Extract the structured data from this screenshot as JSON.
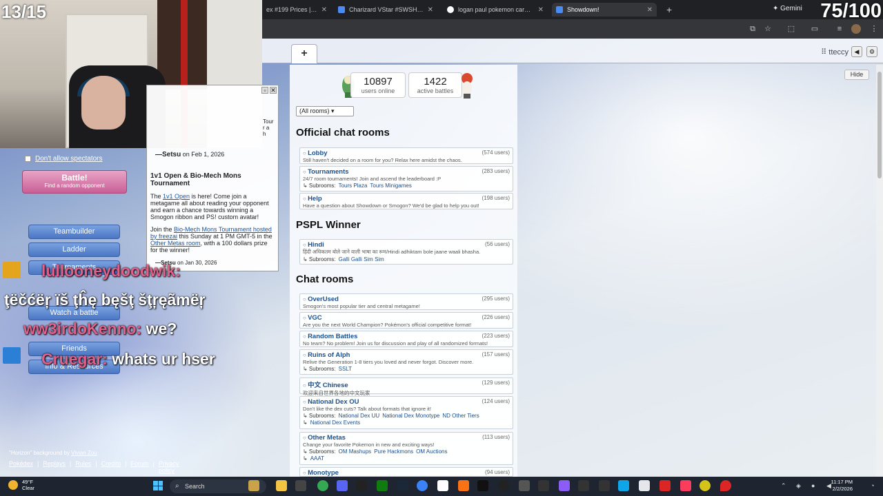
{
  "overlay": {
    "counter_left": "13/15",
    "counter_right": "75/100"
  },
  "browser": {
    "tabs": [
      {
        "label": "ex #199 Prices | Poké",
        "active": false
      },
      {
        "label": "Charizard VStar #SWSH262 Pri",
        "active": false
      },
      {
        "label": "logan paul pokemon card - Go",
        "active": false
      },
      {
        "label": "Showdown!",
        "active": true
      }
    ],
    "new_tab": "+",
    "gemini": "✦ Gemini"
  },
  "showdown": {
    "plus_tab": "+",
    "username": "⠿ tteccy",
    "stats": {
      "users_online_num": "10897",
      "users_online_label": "users online",
      "active_battles_num": "1422",
      "active_battles_label": "active battles"
    },
    "hide_button": "Hide",
    "room_filter": "(All rooms) ▾",
    "sections": [
      {
        "title": "Official chat rooms",
        "rooms": [
          {
            "name": "Lobby",
            "users": "(574 users)",
            "desc": "Still haven't decided on a room for you? Relax here amidst the chaos.",
            "subrooms": []
          },
          {
            "name": "Tournaments",
            "users": "(283 users)",
            "desc": "24/7 room tournaments! Join and ascend the leaderboard :P",
            "subrooms": [
              "Tours Plaza",
              "Tours Minigames"
            ]
          },
          {
            "name": "Help",
            "users": "(198 users)",
            "desc": "Have a question about Showdown or Smogon? We'd be glad to help you out!",
            "subrooms": []
          }
        ]
      },
      {
        "title": "PSPL Winner",
        "rooms": [
          {
            "name": "Hindi",
            "users": "(56 users)",
            "desc": "हिंदी अधिकतम बोले जाने वाली भाषा का रूम/Hindi adhiktam bole jaane waali bhasha.",
            "subrooms": [
              "Galli Galli Sim Sim"
            ]
          }
        ]
      },
      {
        "title": "Chat rooms",
        "rooms": [
          {
            "name": "OverUsed",
            "users": "(295 users)",
            "desc": "Smogon's most popular tier and central metagame!",
            "subrooms": []
          },
          {
            "name": "VGC",
            "users": "(226 users)",
            "desc": "Are you the next World Champion? Pokémon's official competitive format!",
            "subrooms": []
          },
          {
            "name": "Random Battles",
            "users": "(223 users)",
            "desc": "No team? No problem! Join us for discussion and play of all randomized formats!",
            "subrooms": []
          },
          {
            "name": "Ruins of Alph",
            "users": "(157 users)",
            "desc": "Relive the Generation 1-8 tiers you loved and never forgot. Discover more.",
            "subrooms": [
              "SSLT"
            ]
          },
          {
            "name": "中文 Chinese",
            "users": "(129 users)",
            "desc": "欢迎来自世界各地的中文玩家",
            "subrooms": []
          },
          {
            "name": "National Dex OU",
            "users": "(124 users)",
            "desc": "Don't like the dex cuts? Talk about formats that ignore it!",
            "subrooms": [
              "National Dex UU",
              "National Dex Monotype",
              "ND Other Tiers",
              "National Dex Events"
            ]
          },
          {
            "name": "Other Metas",
            "users": "(113 users)",
            "desc": "Change your favorite Pokemon in new and exciting ways!",
            "subrooms": [
              "OM Mashups",
              "Pure Hackmons",
              "OM Auctions",
              "AAAT"
            ]
          },
          {
            "name": "Monotype",
            "users": "(94 users)",
            "desc": "",
            "subrooms": []
          }
        ]
      }
    ],
    "subrooms_label": "↳ Subrooms:"
  },
  "home": {
    "dont_allow_spectators": "Don't allow spectators",
    "battle_title": "Battle!",
    "battle_sub": "Find a random opponent",
    "menu": [
      "Teambuilder",
      "Ladder",
      "Tournaments",
      "Watch a battle",
      "Friends",
      "Info & Resources"
    ],
    "credits_pre": "\"Horizon\" background by ",
    "credits_author": "Vivian Zou",
    "footer_links": [
      "Pokédex",
      "Replays",
      "Rules",
      "Credits",
      "Forum",
      "Privacy policy"
    ]
  },
  "news": {
    "side_text": "Tour\nr a\nh",
    "author_top": "—Setsu",
    "date_top": "on Feb 1, 2026",
    "title": "1v1 Open & Bio-Mech Mons Tournament",
    "p1_pre": "The ",
    "p1_link": "1v1 Open",
    "p1_post": " is here! Come join a metagame all about reading your opponent and earn a chance towards winning a Smogon ribbon and PS! custom avatar!",
    "p2_pre": "Join the ",
    "p2_link1": "Bio-Mech Mons Tournament hosted by freezai",
    "p2_mid": " this Sunday at 1 PM GMT-5 in the ",
    "p2_link2": "Other Metas room",
    "p2_post": ", with a 100 dollars prize for the winner!",
    "author_bottom": "—Setsu",
    "date_bottom": "on Jan 30, 2026"
  },
  "chat": [
    {
      "user": "lullooneydoodwik:",
      "msg": ""
    },
    {
      "user": "",
      "msg": "ţëčćëŗ ïš ţĥę bęšţ šţŗęãmëŗ"
    },
    {
      "user": "ww3irdoKenno:",
      "msg": " we?"
    },
    {
      "user": "Cruegar:",
      "msg": " whats ur hser"
    }
  ],
  "taskbar": {
    "temp": "49°F",
    "condition": "Clear",
    "search": "Search",
    "time": "11:17 PM",
    "date": "2/2/2026"
  },
  "colors": {
    "battle_button": "#c95f96",
    "menu_button": "#4a76c4",
    "room_link": "#1b4f8c",
    "chat_username": "#e0608a"
  }
}
